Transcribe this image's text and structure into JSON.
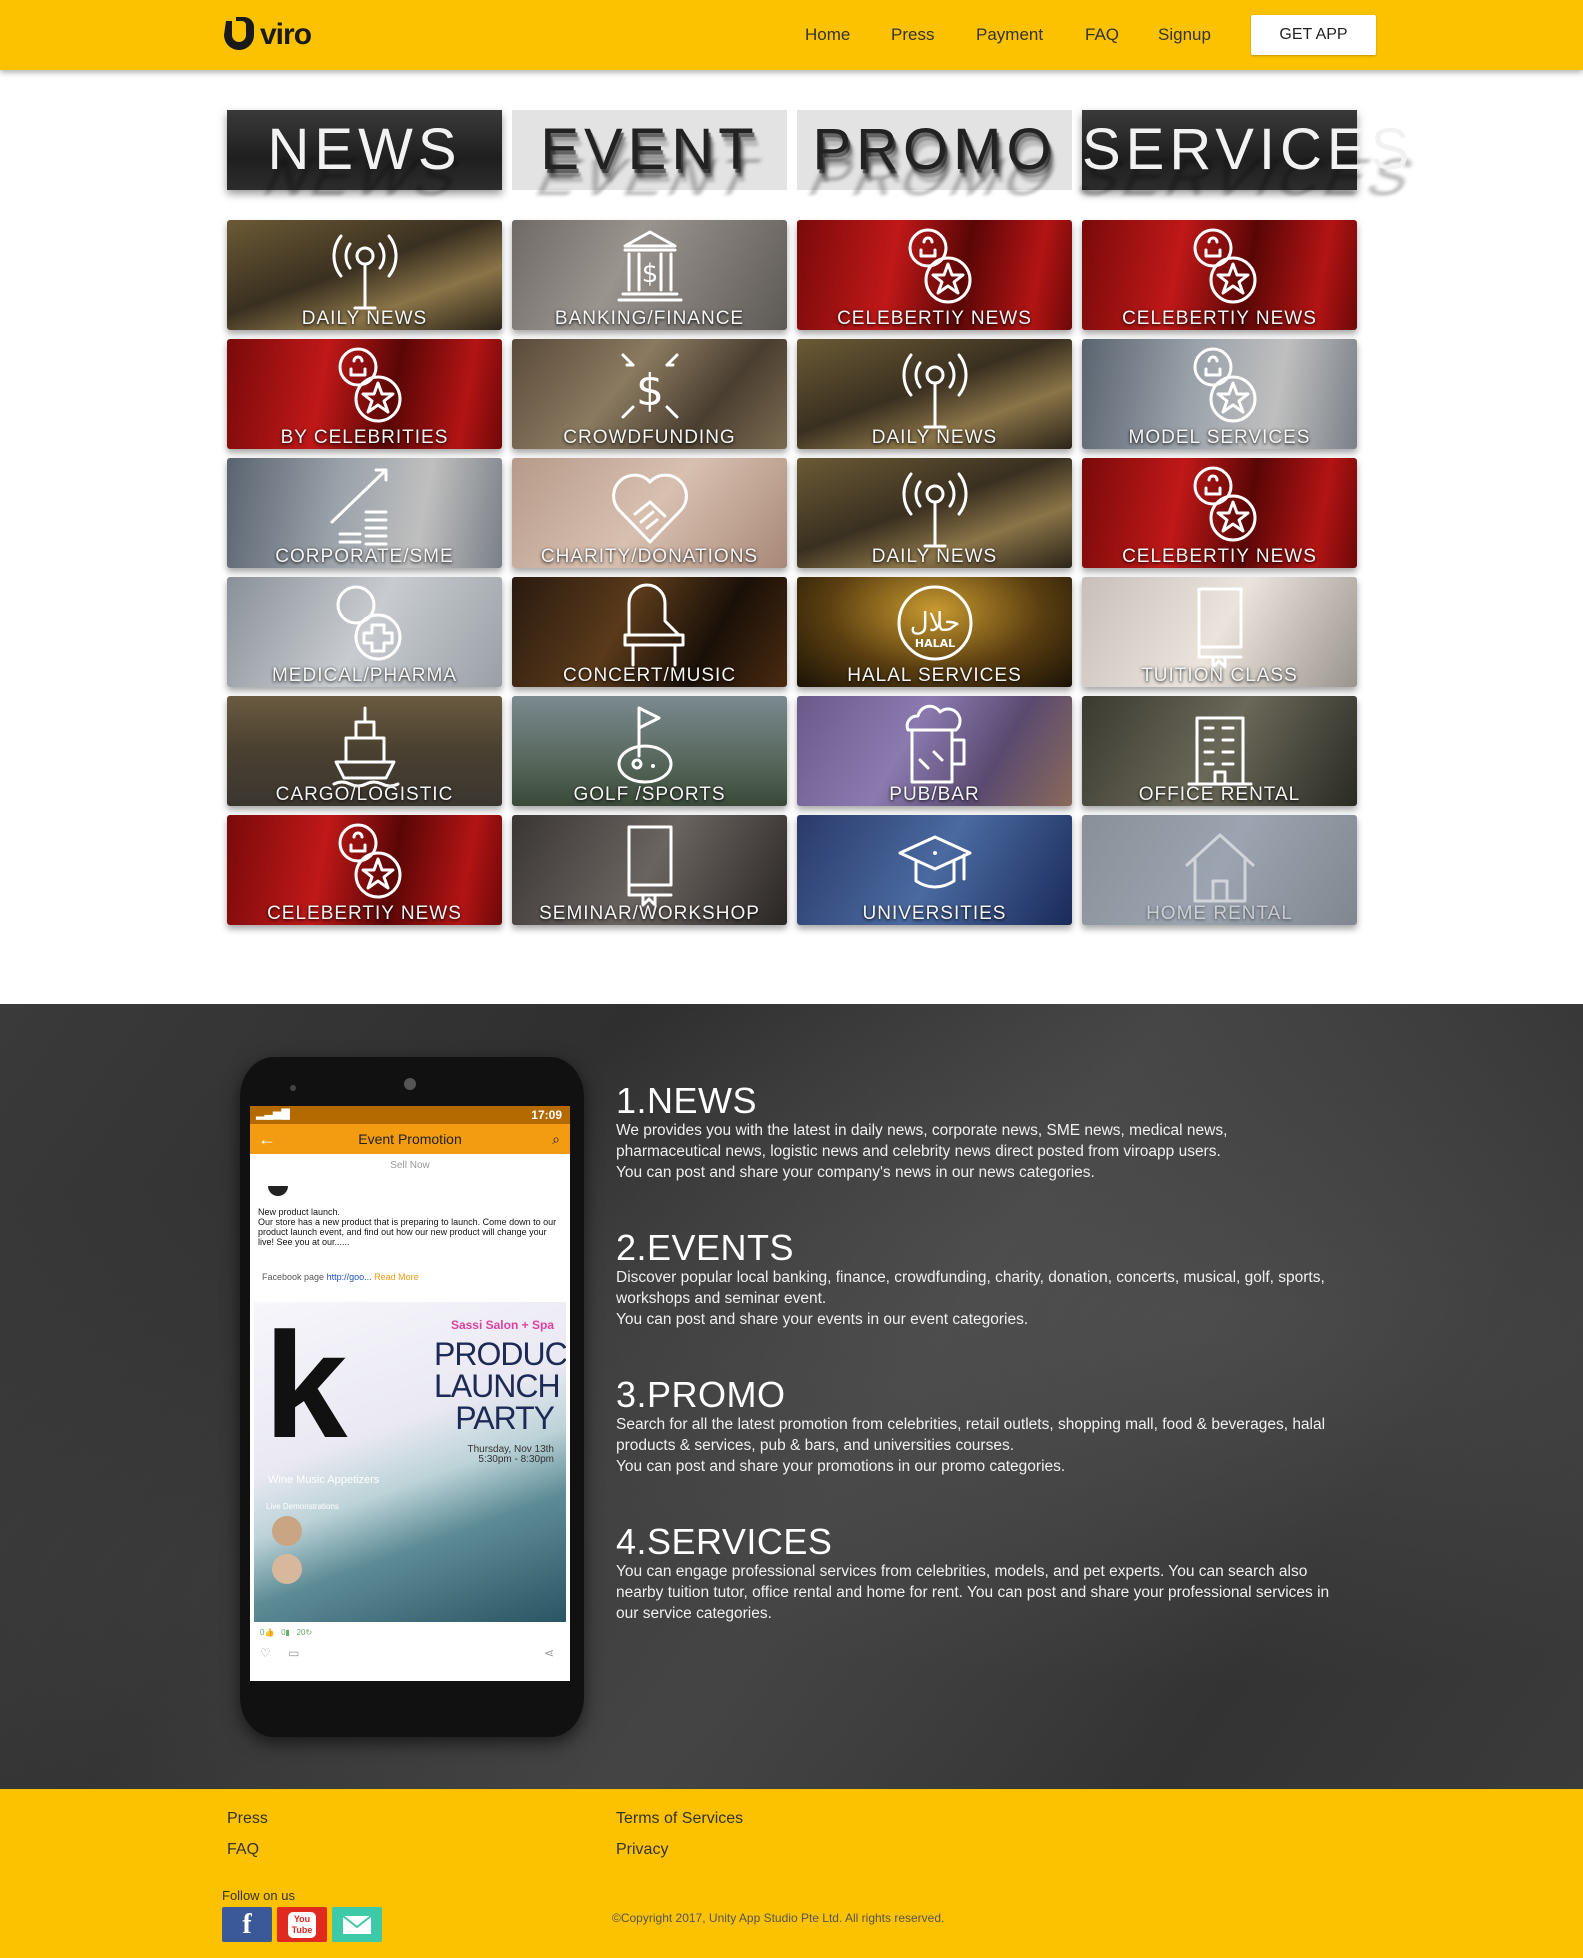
{
  "header": {
    "logo_text": "viro",
    "nav": [
      "Home",
      "Press",
      "Payment",
      "FAQ",
      "Signup"
    ],
    "get_app": "GET APP"
  },
  "categories": [
    "NEWS",
    "EVENT",
    "PROMO",
    "SERVICES"
  ],
  "tiles": [
    [
      "DAILY NEWS",
      "BANKING/FINANCE",
      "CELEBERTIY NEWS",
      "CELEBERTIY NEWS"
    ],
    [
      "BY CELEBRITIES",
      "CROWDFUNDING",
      "DAILY NEWS",
      "MODEL SERVICES"
    ],
    [
      "CORPORATE/SME",
      "CHARITY/DONATIONS",
      "DAILY NEWS",
      "CELEBERTIY NEWS"
    ],
    [
      "MEDICAL/PHARMA",
      "CONCERT/MUSIC",
      "HALAL SERVICES",
      "TUITION CLASS"
    ],
    [
      "CARGO/LOGISTIC",
      "GOLF /SPORTS",
      "PUB/BAR",
      "OFFICE RENTAL"
    ],
    [
      "CELEBERTIY NEWS",
      "SEMINAR/WORKSHOP",
      "UNIVERSITIES",
      "HOME RENTAL"
    ]
  ],
  "phone": {
    "time": "17:09",
    "title": "Event Promotion",
    "sell_now": "Sell Now",
    "post_title": "New product launch.",
    "post_body": "Our store has a new product that is preparing to launch. Come down to our product launch event, and find out how our new product will change your live! See you at our......",
    "fb_label": "Facebook page",
    "fb_link": "http://goo...",
    "read_more": "Read More",
    "poster_brand": "Sassi Salon + Spa",
    "poster_title": "PRODUCT LAUNCH PARTY",
    "poster_date": "Thursday, Nov 13th",
    "poster_time": "5:30pm - 8:30pm",
    "poster_tagline": "Wine  Music  Appetizers",
    "poster_demo": "Live Demonstrations",
    "halal_text": "HALAL"
  },
  "sections": [
    {
      "title": "1.NEWS",
      "lines": [
        "We provides you with the latest in daily news, corporate news, SME news, medical news,",
        "pharmaceutical news, logistic news and celebrity news direct posted from viroapp users.",
        "You can post and share your company's news in our news categories."
      ]
    },
    {
      "title": "2.EVENTS",
      "lines": [
        "Discover popular local banking, finance, crowdfunding, charity, donation, concerts, musical, golf, sports,",
        "workshops and seminar event.",
        "You can post and share your events in our event categories."
      ]
    },
    {
      "title": "3.PROMO",
      "lines": [
        "Search for all the latest promotion from celebrities, retail outlets, shopping mall, food & beverages, halal",
        "products & services, pub & bars, and universities courses.",
        "You can post and share your promotions in our promo categories."
      ]
    },
    {
      "title": "4.SERVICES",
      "lines": [
        "You can engage professional services from celebrities, models, and pet experts. You can search also",
        "nearby tuition tutor, office rental and home for rent. You can post and share your professional services in",
        "our service categories."
      ]
    }
  ],
  "footer": {
    "press": "Press",
    "faq": "FAQ",
    "terms": "Terms of Services",
    "privacy": "Privacy",
    "follow": "Follow on us",
    "copyright": "©Copyright 2017, Unity App Studio Pte Ltd. All rights reserved.",
    "youtube_text": "You Tube"
  },
  "colors": {
    "brand": "#fcc200",
    "dark": "#2f2f2f",
    "facebook": "#3b5998",
    "youtube": "#e02a20",
    "email": "#3ec9a7"
  }
}
